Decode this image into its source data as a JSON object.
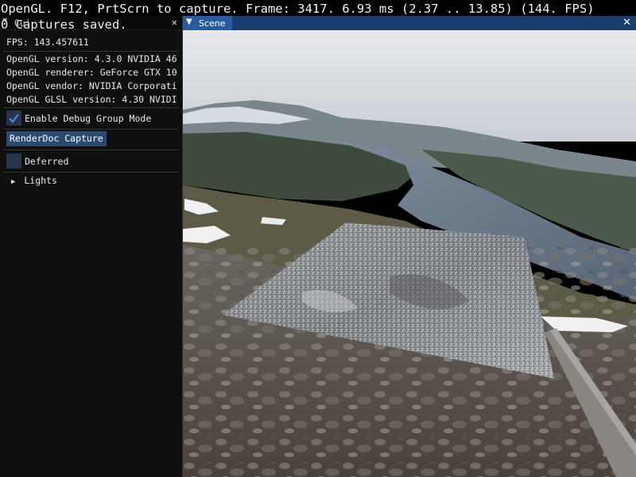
{
  "overlay": {
    "line1": "OpenGL. F12, PrtScrn to capture. Frame: 3417. 6.93 ms (2.37 .. 13.85) (144. FPS)",
    "line2": "0 Captures saved."
  },
  "left_window": {
    "title": "Gui",
    "fps": "FPS: 143.457611",
    "gl_version": "OpenGL version: 4.3.0 NVIDIA 46",
    "gl_renderer": "OpenGL renderer: GeForce GTX 10",
    "gl_vendor": "OpenGL vendor: NVIDIA Corporati",
    "gl_glsl": "OpenGL GLSL version: 4.30 NVIDI",
    "debug_group_label": "Enable Debug Group Mode",
    "debug_group_checked": true,
    "renderdoc_button": "RenderDoc Capture",
    "deferred_label": "Deferred",
    "deferred_checked": false,
    "lights_label": "Lights"
  },
  "scene_window": {
    "title": "Scene"
  },
  "colors": {
    "scene_titlebar": "#1b3d6c",
    "button": "#2a4a72",
    "checkbox_bg": "#26344c",
    "checkmark": "#4d8ae0"
  }
}
